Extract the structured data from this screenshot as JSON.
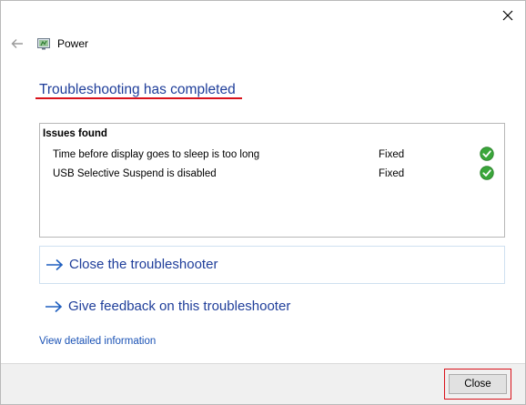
{
  "window": {
    "app_name": "Power",
    "close_icon": "close-x-icon",
    "back_icon": "back-arrow-icon",
    "app_icon": "power-troubleshooter-icon"
  },
  "main": {
    "headline": "Troubleshooting has completed",
    "issues_header": "Issues found",
    "issues": [
      {
        "text": "Time before display goes to sleep is too long",
        "status": "Fixed",
        "status_icon": "green-check-icon"
      },
      {
        "text": "USB Selective Suspend is disabled",
        "status": "Fixed",
        "status_icon": "green-check-icon"
      }
    ],
    "links": [
      {
        "label": "Close the troubleshooter",
        "icon": "right-arrow-icon"
      },
      {
        "label": "Give feedback on this troubleshooter",
        "icon": "right-arrow-icon"
      }
    ],
    "detail_link": "View detailed information"
  },
  "footer": {
    "close_button": "Close"
  },
  "colors": {
    "link_blue": "#1f3e9a",
    "highlight_red": "#d9121b",
    "check_green": "#3aa63a"
  }
}
